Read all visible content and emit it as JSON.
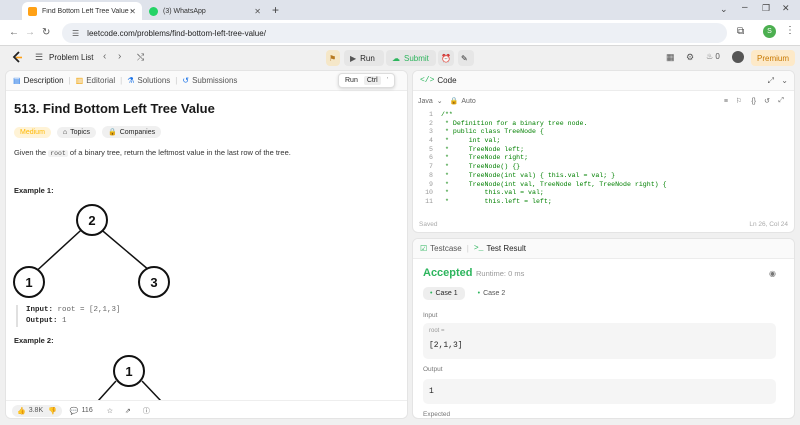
{
  "browser": {
    "tabs": [
      {
        "title": "Find Bottom Left Tree Value - Le"
      },
      {
        "title": "(3) WhatsApp"
      }
    ],
    "url": "leetcode.com/problems/find-bottom-left-tree-value/",
    "profile_initial": "S"
  },
  "nav": {
    "problem_list": "Problem List",
    "run": "Run",
    "submit": "Submit",
    "coins": "0",
    "premium": "Premium"
  },
  "left": {
    "tabs": [
      "Description",
      "Editorial",
      "Solutions",
      "Submissions"
    ],
    "tooltip": {
      "label": "Run",
      "shortcut": "Ctrl",
      "key": "'"
    },
    "title": "513. Find Bottom Left Tree Value",
    "tags": {
      "difficulty": "Medium",
      "topics": "Topics",
      "companies": "Companies"
    },
    "desc_pre": "Given the",
    "desc_code": "root",
    "desc_post": "of a binary tree, return the leftmost value in the last row of the tree.",
    "example1": {
      "title": "Example 1:",
      "nodes": [
        "2",
        "1",
        "3"
      ],
      "input_label": "Input:",
      "input_value": "root = [2,1,3]",
      "output_label": "Output:",
      "output_value": "1"
    },
    "example2": {
      "title": "Example 2:",
      "nodes": [
        "1"
      ]
    },
    "footer": {
      "likes": "3.8K",
      "comments": "116"
    }
  },
  "code": {
    "title": "Code",
    "language": "Java",
    "mode": "Auto",
    "lines": [
      {
        "n": "1",
        "t": "/**"
      },
      {
        "n": "2",
        "t": " * Definition for a binary tree node."
      },
      {
        "n": "3",
        "t": " * public class TreeNode {"
      },
      {
        "n": "4",
        "t": " *     int val;"
      },
      {
        "n": "5",
        "t": " *     TreeNode left;"
      },
      {
        "n": "6",
        "t": " *     TreeNode right;"
      },
      {
        "n": "7",
        "t": " *     TreeNode() {}"
      },
      {
        "n": "8",
        "t": " *     TreeNode(int val) { this.val = val; }"
      },
      {
        "n": "9",
        "t": " *     TreeNode(int val, TreeNode left, TreeNode right) {"
      },
      {
        "n": "10",
        "t": " *         this.val = val;"
      },
      {
        "n": "11",
        "t": " *         this.left = left;"
      }
    ],
    "status": "Saved",
    "cursor": "Ln 26, Col 24"
  },
  "result": {
    "tabs": [
      "Testcase",
      "Test Result"
    ],
    "verdict": "Accepted",
    "runtime": "Runtime: 0 ms",
    "cases": [
      "Case 1",
      "Case 2"
    ],
    "input_label": "Input",
    "var_label": "root =",
    "input_value": "[2,1,3]",
    "output_label": "Output",
    "output_value": "1",
    "expected_label": "Expected"
  },
  "colors": {
    "accent_green": "#2db55d",
    "medium": "#ffb800",
    "accepted": "#2db55d"
  }
}
